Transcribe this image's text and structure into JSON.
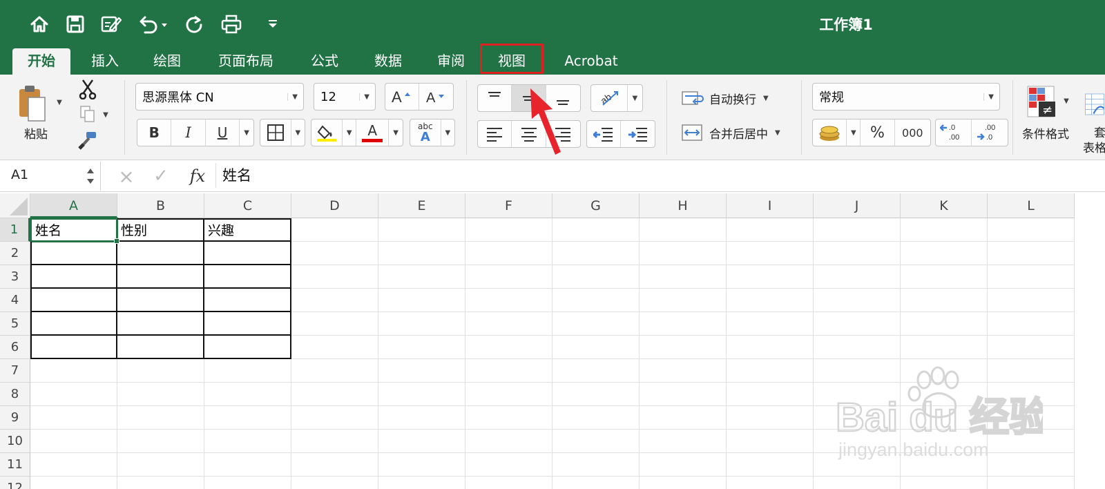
{
  "document": {
    "title": "工作簿1"
  },
  "tabs": [
    {
      "label": "开始",
      "active": true
    },
    {
      "label": "插入"
    },
    {
      "label": "绘图"
    },
    {
      "label": "页面布局"
    },
    {
      "label": "公式"
    },
    {
      "label": "数据"
    },
    {
      "label": "审阅"
    },
    {
      "label": "视图",
      "highlighted": true
    },
    {
      "label": "Acrobat"
    }
  ],
  "ribbon": {
    "paste_label": "粘贴",
    "font_name": "思源黑体 CN",
    "font_size": "12",
    "bold": "B",
    "italic": "I",
    "underline": "U",
    "wrap_text_label": "自动换行",
    "merge_center_label": "合并后居中",
    "number_format": "常规",
    "percent": "%",
    "thousands": "000",
    "increase_decimal": ".0\n.00",
    "decrease_decimal": ".00\n.0",
    "conditional_format_label": "条件格式",
    "format_table_label_1": "套",
    "format_table_label_2": "表格",
    "font_color_letter": "A",
    "abc_label": "abc"
  },
  "colors": {
    "brand": "#217346",
    "highlight_box": "#e02020",
    "arrow": "#e8232b",
    "fill_color_swatch": "#ffee00",
    "font_color_swatch": "#e00000"
  },
  "formula_bar": {
    "name_box": "A1",
    "cancel_icon": "×",
    "enter_icon": "✓",
    "fx_label": "fx",
    "content": "姓名"
  },
  "sheet": {
    "columns": [
      "A",
      "B",
      "C",
      "D",
      "E",
      "F",
      "G",
      "H",
      "I",
      "J",
      "K",
      "L"
    ],
    "rows": [
      "1",
      "2",
      "3",
      "4",
      "5",
      "6",
      "7",
      "8",
      "9",
      "10",
      "11",
      "12"
    ],
    "active_cell": "A1",
    "cells": {
      "A1": "姓名",
      "B1": "性别",
      "C1": "兴趣"
    }
  },
  "watermark": {
    "brand": "Bai du 经验",
    "url": "jingyan.baidu.com"
  }
}
